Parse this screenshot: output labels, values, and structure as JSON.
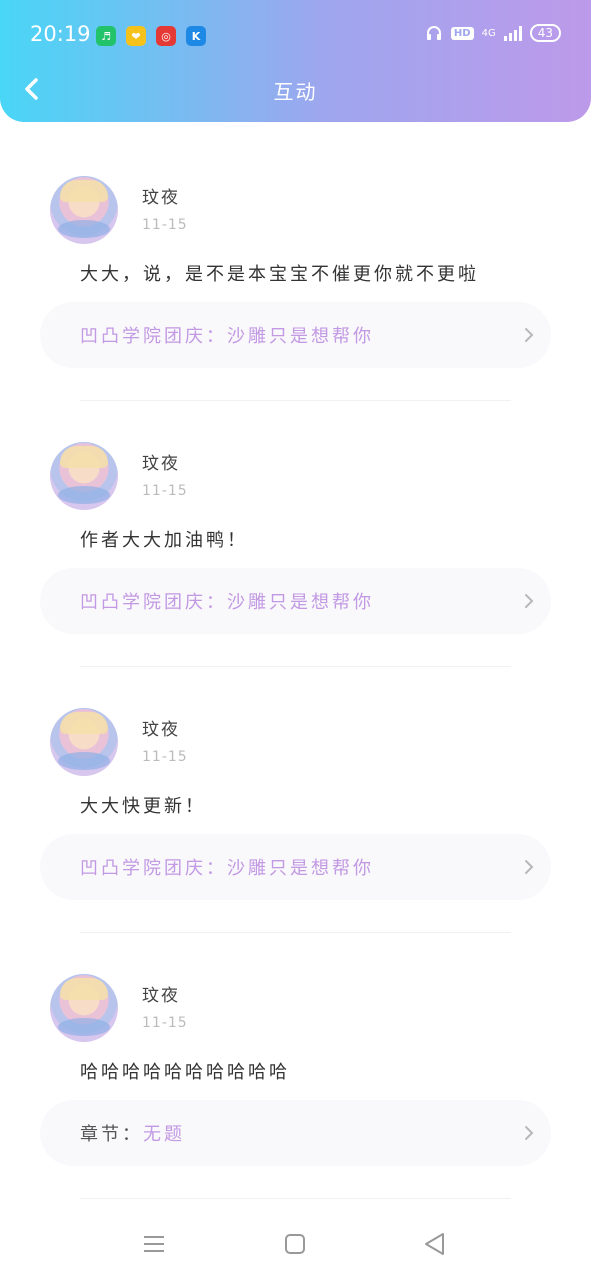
{
  "status_bar": {
    "time": "20:19",
    "hd_label": "HD",
    "network_label": "4G",
    "battery": "43"
  },
  "header": {
    "title": "互动"
  },
  "comments": [
    {
      "name": "玟夜",
      "date": "11-15",
      "text": "大大，说，是不是本宝宝不催更你就不更啦",
      "ref_prefix": "",
      "ref_title": "凹凸学院团庆：沙雕只是想帮你"
    },
    {
      "name": "玟夜",
      "date": "11-15",
      "text": "作者大大加油鸭！",
      "ref_prefix": "",
      "ref_title": "凹凸学院团庆：沙雕只是想帮你"
    },
    {
      "name": "玟夜",
      "date": "11-15",
      "text": "大大快更新！",
      "ref_prefix": "",
      "ref_title": "凹凸学院团庆：沙雕只是想帮你"
    },
    {
      "name": "玟夜",
      "date": "11-15",
      "text": "哈哈哈哈哈哈哈哈哈哈",
      "ref_prefix": "章节：",
      "ref_title": "无题"
    }
  ],
  "colors": {
    "header_gradient_start": "#49d6f6",
    "header_gradient_end": "#bd9aea",
    "ref_text": "#c299e3"
  }
}
